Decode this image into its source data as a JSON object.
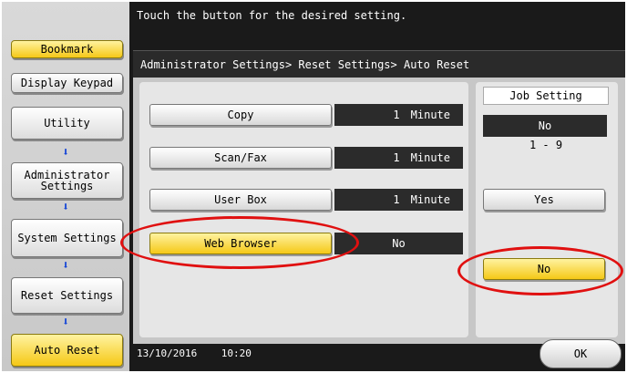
{
  "sidebar": {
    "bookmark": "Bookmark",
    "display_keypad": "Display Keypad",
    "utility": "Utility",
    "administrator_settings": "Administrator Settings",
    "system_settings": "System Settings",
    "reset_settings": "Reset Settings",
    "auto_reset": "Auto Reset"
  },
  "header": {
    "instruction": "Touch the button for the desired setting.",
    "breadcrumb": "Administrator Settings> Reset Settings> Auto Reset"
  },
  "settings": [
    {
      "label": "Copy",
      "value": "1",
      "unit": "Minute"
    },
    {
      "label": "Scan/Fax",
      "value": "1",
      "unit": "Minute"
    },
    {
      "label": "User Box",
      "value": "1",
      "unit": "Minute"
    },
    {
      "label": "Web Browser",
      "value": "No",
      "unit": ""
    }
  ],
  "job_setting": {
    "title": "Job Setting",
    "current": "No",
    "range": "1  -  9",
    "yes_label": "Yes",
    "no_label": "No"
  },
  "footer": {
    "date": "13/10/2016",
    "time": "10:20",
    "ok_label": "OK"
  },
  "colors": {
    "highlight_yellow": "#f5c816",
    "annotation_red": "#e01010",
    "arrow_blue": "#1a49d6"
  }
}
